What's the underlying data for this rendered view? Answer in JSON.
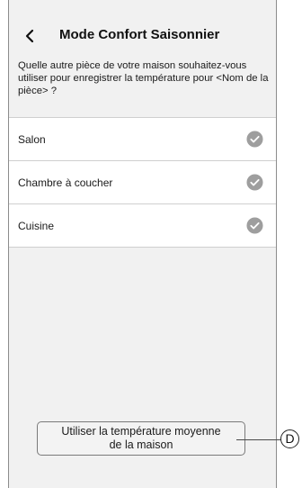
{
  "header": {
    "back_icon": "chevron-left-icon",
    "title": "Mode Confort Saisonnier"
  },
  "question": "Quelle autre pièce de votre maison souhaitez-vous utiliser pour enregistrer la température pour <Nom de la pièce> ?",
  "rooms": [
    {
      "label": "Salon",
      "icon": "check-circle-icon"
    },
    {
      "label": "Chambre à coucher",
      "icon": "check-circle-icon"
    },
    {
      "label": "Cuisine",
      "icon": "check-circle-icon"
    }
  ],
  "average_button": {
    "line1": "Utiliser la température moyenne",
    "line2": "de la maison"
  },
  "callout": {
    "label": "D"
  },
  "colors": {
    "screen_bg": "#f1f1f1",
    "check_circle": "#9e9e9e"
  }
}
